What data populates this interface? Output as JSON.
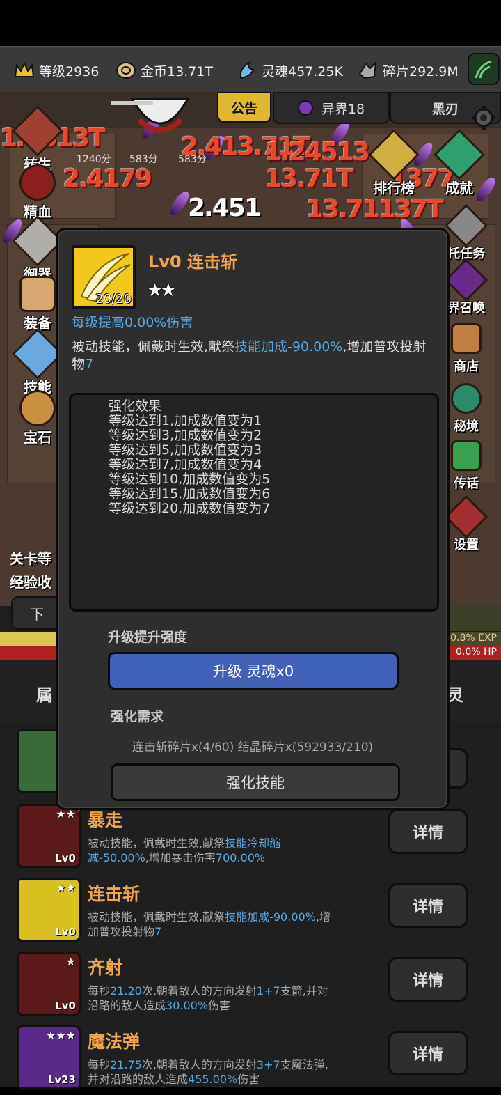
{
  "resources": [
    {
      "icon": "crown-icon",
      "text": "等级2936"
    },
    {
      "icon": "coin-icon",
      "text": "金币13.71T"
    },
    {
      "icon": "soul-icon",
      "text": "灵魂457.25K"
    },
    {
      "icon": "shard-icon",
      "text": "碎片292.9M"
    }
  ],
  "top_tabs": {
    "notice": "公告",
    "otherworld": "异界18",
    "blackblade": "黑刃"
  },
  "left_menu": [
    "转生",
    "精血",
    "御器",
    "装备",
    "技能",
    "宝石"
  ],
  "right_menu": [
    "排行榜",
    "成就",
    "托任务",
    "界召唤",
    "商店",
    "秘境",
    "传话",
    "设置"
  ],
  "score_labels": [
    "1240分",
    "583分",
    "583分"
  ],
  "bottom_labels": {
    "stage": "关卡等",
    "exp": "经验收",
    "down": "下",
    "exp_pct": "0.8% EXP",
    "hp_pct": "0.0% HP"
  },
  "bottom_tabs": {
    "left": "属",
    "right": "灵"
  },
  "damage_numbers": [
    "1.4513T",
    "2.413.71T",
    "1.24513",
    "2.4179",
    "13.71T",
    "2.451",
    "1377",
    "13.71137T"
  ],
  "modal": {
    "title": "Lv0 连击斩",
    "stars": "★★",
    "count": "20/20",
    "per_level": "每级提高0.00%伤害",
    "desc_prefix": "被动技能，佩戴时生效,献祭",
    "desc_highlight": "技能加成-90.00%",
    "desc_mid": ",增加普攻投射物",
    "desc_num": "7",
    "effects_title": "强化效果",
    "effects": [
      "等级达到1,加成数值变为1",
      "等级达到3,加成数值变为2",
      "等级达到5,加成数值变为3",
      "等级达到7,加成数值变为4",
      "等级达到10,加成数值变为5",
      "等级达到15,加成数值变为6",
      "等级达到20,加成数值变为7"
    ],
    "upgrade_section": "升级提升强度",
    "upgrade_button": "升级 灵魂x0",
    "req_section": "强化需求",
    "requirement": "连击斩碎片x(4/60) 结晶碎片x(592933/210)",
    "strengthen_button": "强化技能"
  },
  "skills": [
    {
      "name": "暴走",
      "lv": "Lv0",
      "stars": "★★",
      "color": "#5a1a1a",
      "desc": [
        {
          "t": "被动技能，佩戴时生效,献祭"
        },
        {
          "t": "技能冷却缩减-50.00%",
          "h": true
        },
        {
          "t": ",增加暴击伤害"
        },
        {
          "t": "700.00%",
          "h": true
        }
      ],
      "button": "详情"
    },
    {
      "name": "连击斩",
      "lv": "Lv0",
      "stars": "★★",
      "color": "#d8c020",
      "desc": [
        {
          "t": "被动技能，佩戴时生效,献祭"
        },
        {
          "t": "技能加成-90.00%",
          "h": true
        },
        {
          "t": ",增加普攻投射物"
        },
        {
          "t": "7",
          "h": true
        }
      ],
      "button": "详情"
    },
    {
      "name": "齐射",
      "lv": "Lv0",
      "stars": "★",
      "color": "#5a1a1a",
      "desc": [
        {
          "t": "每秒"
        },
        {
          "t": "21.20",
          "h": true
        },
        {
          "t": "次,朝着敌人的方向发射"
        },
        {
          "t": "1+7",
          "h": true
        },
        {
          "t": "支箭,并对沿路的敌人造成"
        },
        {
          "t": "30.00%",
          "h": true
        },
        {
          "t": "伤害"
        }
      ],
      "button": "详情"
    },
    {
      "name": "魔法弹",
      "lv": "Lv23",
      "stars": "★★★",
      "color": "#5a2a8a",
      "desc": [
        {
          "t": "每秒"
        },
        {
          "t": "21.75",
          "h": true
        },
        {
          "t": "次,朝着敌人的方向发射"
        },
        {
          "t": "3+7",
          "h": true
        },
        {
          "t": "支魔法弹,并对沿路的敌人造成"
        },
        {
          "t": "455.00%",
          "h": true
        },
        {
          "t": "伤害"
        }
      ],
      "button": "详情"
    }
  ],
  "colors": {
    "accent_orange": "#f0a64a",
    "highlight_blue": "#5aa8e0",
    "button_blue": "#3f62b8",
    "hp_red": "#b02020"
  }
}
